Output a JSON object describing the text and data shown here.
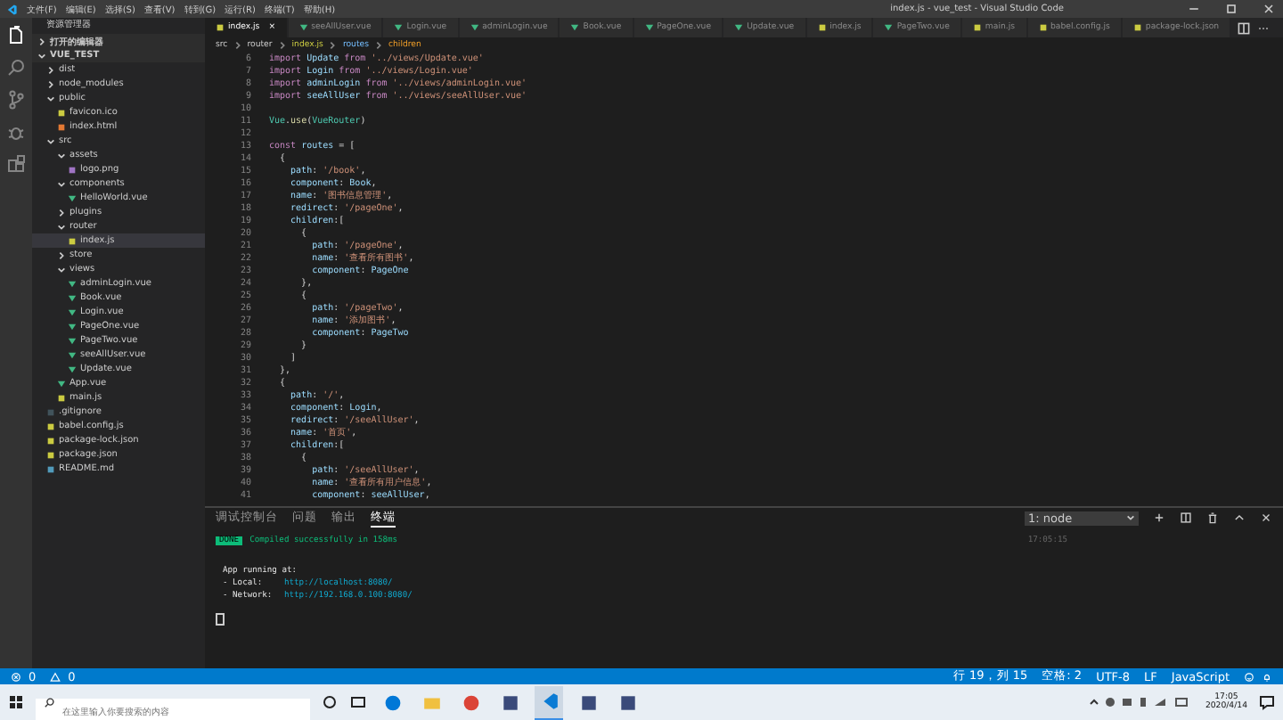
{
  "window": {
    "title": "index.js - vue_test - Visual Studio Code"
  },
  "menu": [
    "文件(F)",
    "编辑(E)",
    "选择(S)",
    "查看(V)",
    "转到(G)",
    "运行(R)",
    "终端(T)",
    "帮助(H)"
  ],
  "activity_bar": [
    {
      "kind": "files",
      "selected": true
    },
    {
      "kind": "search",
      "selected": false
    },
    {
      "kind": "source",
      "selected": false
    },
    {
      "kind": "debug",
      "selected": false
    },
    {
      "kind": "extensions",
      "selected": false
    }
  ],
  "explorer": {
    "title": "资源管理器",
    "sections": [
      {
        "label": "打开的编辑器",
        "expanded": false
      },
      {
        "label": "VUE_TEST",
        "expanded": true,
        "children": [
          {
            "label": "dist",
            "kind": "folder",
            "expanded": false,
            "selected": false
          },
          {
            "label": "node_modules",
            "kind": "folder",
            "expanded": false,
            "selected": false
          },
          {
            "label": "public",
            "kind": "folder",
            "expanded": true,
            "selected": false,
            "children": [
              {
                "label": "favicon.ico",
                "kind": "ico",
                "selected": false
              },
              {
                "label": "index.html",
                "kind": "html",
                "selected": false
              }
            ]
          },
          {
            "label": "src",
            "kind": "folder",
            "expanded": true,
            "selected": false,
            "children": [
              {
                "label": "assets",
                "kind": "folder",
                "expanded": true,
                "selected": false,
                "children": [
                  {
                    "label": "logo.png",
                    "kind": "img",
                    "selected": false
                  }
                ]
              },
              {
                "label": "components",
                "kind": "folder",
                "expanded": true,
                "selected": false,
                "children": [
                  {
                    "label": "HelloWorld.vue",
                    "kind": "vue",
                    "selected": false
                  }
                ]
              },
              {
                "label": "plugins",
                "kind": "folder",
                "expanded": false,
                "selected": false
              },
              {
                "label": "router",
                "kind": "folder",
                "expanded": true,
                "selected": false,
                "children": [
                  {
                    "label": "index.js",
                    "kind": "js",
                    "selected": true
                  }
                ]
              },
              {
                "label": "store",
                "kind": "folder",
                "expanded": false,
                "selected": false
              },
              {
                "label": "views",
                "kind": "folder",
                "expanded": true,
                "selected": false,
                "children": [
                  {
                    "label": "adminLogin.vue",
                    "kind": "vue",
                    "selected": false
                  },
                  {
                    "label": "Book.vue",
                    "kind": "vue",
                    "selected": false
                  },
                  {
                    "label": "Login.vue",
                    "kind": "vue",
                    "selected": false
                  },
                  {
                    "label": "PageOne.vue",
                    "kind": "vue",
                    "selected": false
                  },
                  {
                    "label": "PageTwo.vue",
                    "kind": "vue",
                    "selected": false
                  },
                  {
                    "label": "seeAllUser.vue",
                    "kind": "vue",
                    "selected": false
                  },
                  {
                    "label": "Update.vue",
                    "kind": "vue",
                    "selected": false
                  }
                ]
              },
              {
                "label": "App.vue",
                "kind": "vue",
                "selected": false
              },
              {
                "label": "main.js",
                "kind": "js",
                "selected": false
              }
            ]
          },
          {
            "label": ".gitignore",
            "kind": "git",
            "selected": false
          },
          {
            "label": "babel.config.js",
            "kind": "js",
            "selected": false
          },
          {
            "label": "package-lock.json",
            "kind": "json",
            "selected": false
          },
          {
            "label": "package.json",
            "kind": "json",
            "selected": false
          },
          {
            "label": "README.md",
            "kind": "md",
            "selected": false
          }
        ]
      }
    ]
  },
  "tabs": [
    {
      "label": "index.js",
      "kind": "js",
      "selected": true,
      "close": "×"
    },
    {
      "label": "seeAllUser.vue",
      "kind": "vue",
      "selected": false
    },
    {
      "label": "Login.vue",
      "kind": "vue",
      "selected": false
    },
    {
      "label": "adminLogin.vue",
      "kind": "vue",
      "selected": false
    },
    {
      "label": "Book.vue",
      "kind": "vue",
      "selected": false
    },
    {
      "label": "PageOne.vue",
      "kind": "vue",
      "selected": false
    },
    {
      "label": "Update.vue",
      "kind": "vue",
      "selected": false
    },
    {
      "label": "index.js",
      "kind": "js",
      "selected": false
    },
    {
      "label": "PageTwo.vue",
      "kind": "vue",
      "selected": false
    },
    {
      "label": "main.js",
      "kind": "js",
      "selected": false
    },
    {
      "label": "babel.config.js",
      "kind": "js",
      "selected": false
    },
    {
      "label": "package-lock.json",
      "kind": "json",
      "selected": false
    }
  ],
  "breadcrumb": [
    {
      "label": "src",
      "kind": "folder"
    },
    {
      "label": "router",
      "kind": "folder"
    },
    {
      "label": "index.js",
      "kind": "js"
    },
    {
      "label": "routes",
      "kind": "variable"
    },
    {
      "label": "children",
      "kind": "property"
    }
  ],
  "code": [
    {
      "n": "6",
      "t": [
        {
          "text": "import",
          "kind": "keyword"
        },
        {
          "text": " Update ",
          "kind": "variable"
        },
        {
          "text": "from",
          "kind": "keyword"
        },
        {
          "text": " '../views/Update.vue'",
          "kind": "string"
        }
      ]
    },
    {
      "n": "7",
      "t": [
        {
          "text": "import",
          "kind": "keyword"
        },
        {
          "text": " Login ",
          "kind": "variable"
        },
        {
          "text": "from",
          "kind": "keyword"
        },
        {
          "text": " '../views/Login.vue'",
          "kind": "string"
        }
      ]
    },
    {
      "n": "8",
      "t": [
        {
          "text": "import",
          "kind": "keyword"
        },
        {
          "text": " adminLogin ",
          "kind": "variable"
        },
        {
          "text": "from",
          "kind": "keyword"
        },
        {
          "text": " '../views/adminLogin.vue'",
          "kind": "string"
        }
      ]
    },
    {
      "n": "9",
      "t": [
        {
          "text": "import",
          "kind": "keyword"
        },
        {
          "text": " seeAllUser ",
          "kind": "variable"
        },
        {
          "text": "from",
          "kind": "keyword"
        },
        {
          "text": " '../views/seeAllUser.vue'",
          "kind": "string"
        }
      ]
    },
    {
      "n": "10"
    },
    {
      "n": "11",
      "t": [
        {
          "text": "Vue",
          "kind": "class"
        },
        {
          "text": ".",
          "kind": "plain"
        },
        {
          "text": "use",
          "kind": "function"
        },
        {
          "text": "(",
          "kind": "plain"
        },
        {
          "text": "VueRouter",
          "kind": "class"
        },
        {
          "text": ")",
          "kind": "plain"
        }
      ]
    },
    {
      "n": "12"
    },
    {
      "n": "13",
      "t": [
        {
          "text": "const",
          "kind": "keyword"
        },
        {
          "text": " routes ",
          "kind": "variable"
        },
        {
          "text": "= [",
          "kind": "plain"
        }
      ]
    },
    {
      "n": "14",
      "t": [
        {
          "text": "  {",
          "kind": "plain"
        }
      ]
    },
    {
      "n": "15",
      "t": [
        {
          "text": "    path",
          "kind": "variable"
        },
        {
          "text": ": ",
          "kind": "plain"
        },
        {
          "text": "'/book'",
          "kind": "string"
        },
        {
          "text": ",",
          "kind": "plain"
        }
      ]
    },
    {
      "n": "16",
      "t": [
        {
          "text": "    component",
          "kind": "variable"
        },
        {
          "text": ": ",
          "kind": "plain"
        },
        {
          "text": "Book",
          "kind": "variable"
        },
        {
          "text": ",",
          "kind": "plain"
        }
      ]
    },
    {
      "n": "17",
      "t": [
        {
          "text": "    name",
          "kind": "variable"
        },
        {
          "text": ": ",
          "kind": "plain"
        },
        {
          "text": "'图书信息管理'",
          "kind": "string"
        },
        {
          "text": ",",
          "kind": "plain"
        }
      ]
    },
    {
      "n": "18",
      "t": [
        {
          "text": "    redirect",
          "kind": "variable"
        },
        {
          "text": ": ",
          "kind": "plain"
        },
        {
          "text": "'/pageOne'",
          "kind": "string"
        },
        {
          "text": ",",
          "kind": "plain"
        }
      ]
    },
    {
      "n": "19",
      "t": [
        {
          "text": "    children",
          "kind": "variable"
        },
        {
          "text": ":[",
          "kind": "plain"
        }
      ]
    },
    {
      "n": "20",
      "t": [
        {
          "text": "      {",
          "kind": "plain"
        }
      ]
    },
    {
      "n": "21",
      "t": [
        {
          "text": "        path",
          "kind": "variable"
        },
        {
          "text": ": ",
          "kind": "plain"
        },
        {
          "text": "'/pageOne'",
          "kind": "string"
        },
        {
          "text": ",",
          "kind": "plain"
        }
      ]
    },
    {
      "n": "22",
      "t": [
        {
          "text": "        name",
          "kind": "variable"
        },
        {
          "text": ": ",
          "kind": "plain"
        },
        {
          "text": "'查看所有图书'",
          "kind": "string"
        },
        {
          "text": ",",
          "kind": "plain"
        }
      ]
    },
    {
      "n": "23",
      "t": [
        {
          "text": "        component",
          "kind": "variable"
        },
        {
          "text": ": ",
          "kind": "plain"
        },
        {
          "text": "PageOne",
          "kind": "variable"
        }
      ]
    },
    {
      "n": "24",
      "t": [
        {
          "text": "      },",
          "kind": "plain"
        }
      ]
    },
    {
      "n": "25",
      "t": [
        {
          "text": "      {",
          "kind": "plain"
        }
      ]
    },
    {
      "n": "26",
      "t": [
        {
          "text": "        path",
          "kind": "variable"
        },
        {
          "text": ": ",
          "kind": "plain"
        },
        {
          "text": "'/pageTwo'",
          "kind": "string"
        },
        {
          "text": ",",
          "kind": "plain"
        }
      ]
    },
    {
      "n": "27",
      "t": [
        {
          "text": "        name",
          "kind": "variable"
        },
        {
          "text": ": ",
          "kind": "plain"
        },
        {
          "text": "'添加图书'",
          "kind": "string"
        },
        {
          "text": ",",
          "kind": "plain"
        }
      ]
    },
    {
      "n": "28",
      "t": [
        {
          "text": "        component",
          "kind": "variable"
        },
        {
          "text": ": ",
          "kind": "plain"
        },
        {
          "text": "PageTwo",
          "kind": "variable"
        }
      ]
    },
    {
      "n": "29",
      "t": [
        {
          "text": "      }",
          "kind": "plain"
        }
      ]
    },
    {
      "n": "30",
      "t": [
        {
          "text": "    ]",
          "kind": "plain"
        }
      ]
    },
    {
      "n": "31",
      "t": [
        {
          "text": "  },",
          "kind": "plain"
        }
      ]
    },
    {
      "n": "32",
      "t": [
        {
          "text": "  {",
          "kind": "plain"
        }
      ]
    },
    {
      "n": "33",
      "t": [
        {
          "text": "    path",
          "kind": "variable"
        },
        {
          "text": ": ",
          "kind": "plain"
        },
        {
          "text": "'/'",
          "kind": "string"
        },
        {
          "text": ",",
          "kind": "plain"
        }
      ]
    },
    {
      "n": "34",
      "t": [
        {
          "text": "    component",
          "kind": "variable"
        },
        {
          "text": ": ",
          "kind": "plain"
        },
        {
          "text": "Login",
          "kind": "variable"
        },
        {
          "text": ",",
          "kind": "plain"
        }
      ]
    },
    {
      "n": "35",
      "t": [
        {
          "text": "    redirect",
          "kind": "variable"
        },
        {
          "text": ": ",
          "kind": "plain"
        },
        {
          "text": "'/seeAllUser'",
          "kind": "string"
        },
        {
          "text": ",",
          "kind": "plain"
        }
      ]
    },
    {
      "n": "36",
      "t": [
        {
          "text": "    name",
          "kind": "variable"
        },
        {
          "text": ": ",
          "kind": "plain"
        },
        {
          "text": "'首页'",
          "kind": "string"
        },
        {
          "text": ",",
          "kind": "plain"
        }
      ]
    },
    {
      "n": "37",
      "t": [
        {
          "text": "    children",
          "kind": "variable"
        },
        {
          "text": ":[",
          "kind": "plain"
        }
      ]
    },
    {
      "n": "38",
      "t": [
        {
          "text": "      {",
          "kind": "plain"
        }
      ]
    },
    {
      "n": "39",
      "t": [
        {
          "text": "        path",
          "kind": "variable"
        },
        {
          "text": ": ",
          "kind": "plain"
        },
        {
          "text": "'/seeAllUser'",
          "kind": "string"
        },
        {
          "text": ",",
          "kind": "plain"
        }
      ]
    },
    {
      "n": "40",
      "t": [
        {
          "text": "        name",
          "kind": "variable"
        },
        {
          "text": ": ",
          "kind": "plain"
        },
        {
          "text": "'查看所有用户信息'",
          "kind": "string"
        },
        {
          "text": ",",
          "kind": "plain"
        }
      ]
    },
    {
      "n": "41",
      "t": [
        {
          "text": "        component",
          "kind": "variable"
        },
        {
          "text": ": ",
          "kind": "plain"
        },
        {
          "text": "seeAllUser",
          "kind": "variable"
        },
        {
          "text": ",",
          "kind": "plain"
        }
      ]
    }
  ],
  "panel": {
    "tabs": [
      {
        "label": "调试控制台",
        "selected": false
      },
      {
        "label": "问题",
        "selected": false
      },
      {
        "label": "输出",
        "selected": false
      },
      {
        "label": "终端",
        "selected": true
      }
    ],
    "terminal_select": "1: node",
    "done": {
      "badge": "DONE",
      "text": "Compiled successfully in 158ms",
      "time": "17:05:15"
    },
    "lines": [
      {
        "label": "App running at:"
      },
      {
        "label": "- Local:   ",
        "url": "http://localhost:8080/"
      },
      {
        "label": "- Network: ",
        "url": "http://192.168.0.100:8080/"
      }
    ]
  },
  "status_bar": {
    "errors": "0",
    "warnings": "0",
    "items": [
      "行 19，列 15",
      "空格: 2",
      "UTF-8",
      "LF",
      "JavaScript"
    ]
  },
  "taskbar": {
    "search_placeholder": "在这里输入你要搜索的内容",
    "apps": [
      {
        "kind": "edge",
        "selected": false
      },
      {
        "kind": "folder",
        "selected": false
      },
      {
        "kind": "chrome",
        "selected": false
      },
      {
        "kind": "app",
        "selected": false
      },
      {
        "kind": "vscode",
        "selected": true
      },
      {
        "kind": "app",
        "selected": false
      },
      {
        "kind": "app",
        "selected": false
      }
    ],
    "time": "17:05",
    "date": "2020/4/14"
  }
}
